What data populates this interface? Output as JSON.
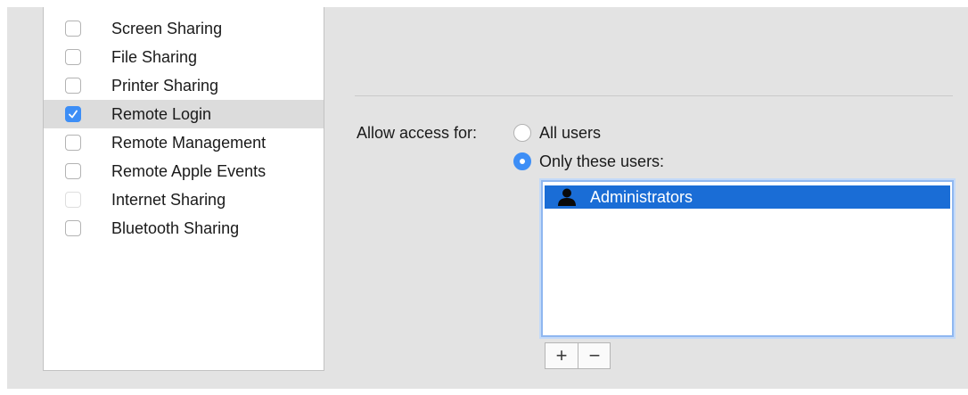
{
  "services": {
    "items": [
      {
        "label": "Screen Sharing",
        "checked": false,
        "enabled": true
      },
      {
        "label": "File Sharing",
        "checked": false,
        "enabled": true
      },
      {
        "label": "Printer Sharing",
        "checked": false,
        "enabled": true
      },
      {
        "label": "Remote Login",
        "checked": true,
        "enabled": true,
        "selected": true
      },
      {
        "label": "Remote Management",
        "checked": false,
        "enabled": true
      },
      {
        "label": "Remote Apple Events",
        "checked": false,
        "enabled": true
      },
      {
        "label": "Internet Sharing",
        "checked": false,
        "enabled": false
      },
      {
        "label": "Bluetooth Sharing",
        "checked": false,
        "enabled": true
      }
    ]
  },
  "access": {
    "label": "Allow access for:",
    "options": [
      {
        "label": "All users",
        "selected": false
      },
      {
        "label": "Only these users:",
        "selected": true
      }
    ]
  },
  "users": {
    "items": [
      {
        "name": "Administrators",
        "icon": "person-icon",
        "selected": true
      }
    ]
  },
  "buttons": {
    "add_label": "+",
    "remove_label": "−"
  },
  "colors": {
    "accent": "#3d8ef6",
    "selection": "#1a6dd6"
  }
}
